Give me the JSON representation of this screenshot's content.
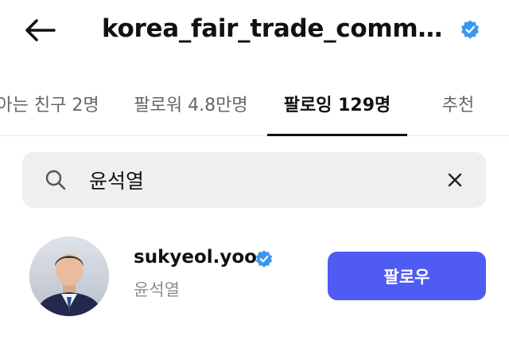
{
  "header": {
    "title": "korea_fair_trade_commission",
    "back_icon": "back-arrow-icon",
    "verified_icon": "verified-badge-icon"
  },
  "tabs": [
    {
      "label": "아는 친구 2명",
      "active": false
    },
    {
      "label": "팔로워 4.8만명",
      "active": false
    },
    {
      "label": "팔로잉 129명",
      "active": true
    },
    {
      "label": "추천",
      "active": false
    }
  ],
  "search": {
    "value": "윤석열",
    "search_icon": "search-icon",
    "clear_icon": "close-icon"
  },
  "result": {
    "username": "sukyeol.yoon",
    "full_name": "윤석열",
    "follow_label": "팔로우",
    "verified_icon": "verified-badge-icon"
  },
  "colors": {
    "verified": "#3897f0",
    "follow_button": "#4f5bf2",
    "search_background": "#efefef"
  }
}
